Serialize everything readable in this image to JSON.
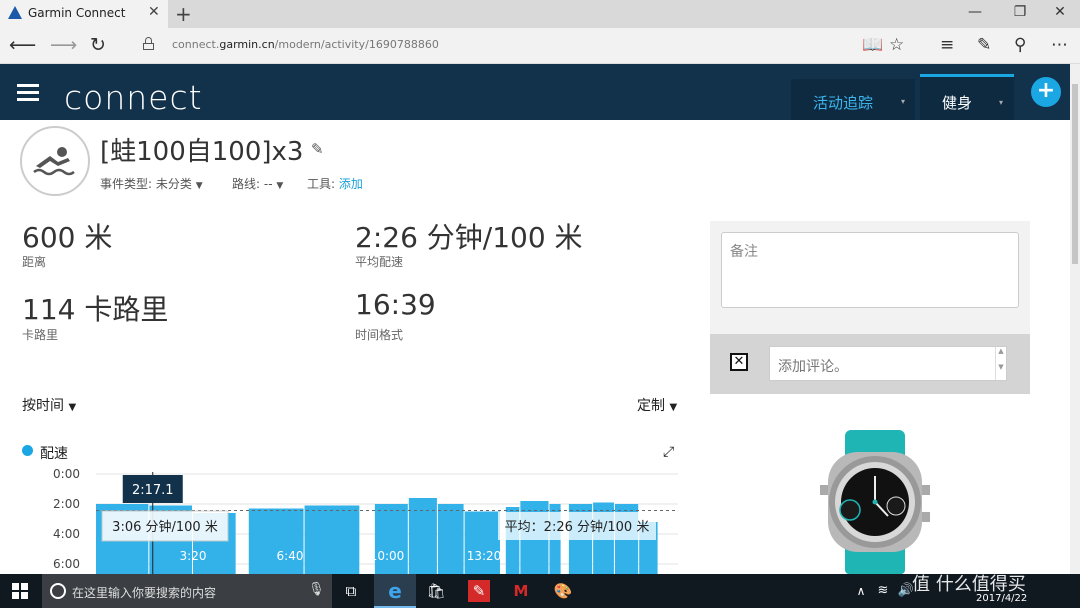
{
  "browser": {
    "tab_title": "Garmin Connect",
    "tab_close": "✕",
    "new_tab": "+",
    "url_prefix": "connect.",
    "url_domain": "garmin.cn",
    "url_path": "/modern/activity/1690788860",
    "win_min": "—",
    "win_max": "❐",
    "win_close": "✕"
  },
  "header": {
    "brand": "connect",
    "nav_activity": "活动追踪",
    "nav_fitness": "健身",
    "caret": "▾",
    "add": "+"
  },
  "activity": {
    "title": "[蛙100自100]x3",
    "event_type_label": "事件类型: ",
    "event_type_value": "未分类",
    "route_label": "路线: ",
    "route_value": "--",
    "tool_label": "工具: ",
    "tool_link": "添加",
    "caret": "▼"
  },
  "stats": [
    {
      "value": "600 米",
      "label": "距离"
    },
    {
      "value": "2:26 分钟/100 米",
      "label": "平均配速"
    },
    {
      "value": "114 卡路里",
      "label": "卡路里"
    },
    {
      "value": "16:39",
      "label": "时间格式"
    }
  ],
  "chart_controls": {
    "by_time": "按时间",
    "customize": "定制",
    "caret": "▼",
    "legend": "配速"
  },
  "chart_data": {
    "type": "bar",
    "title": "",
    "xlabel": "",
    "ylabel": "",
    "y_ticks": [
      "0:00",
      "2:00",
      "4:00",
      "6:00"
    ],
    "y_reversed": true,
    "ylim": [
      0,
      6
    ],
    "x_ticks": [
      "3:20",
      "6:40",
      "10:00",
      "13:20"
    ],
    "series": [
      {
        "name": "配速",
        "color": "#33b2ea",
        "bars": [
          {
            "start_s": 0,
            "end_s": 110,
            "pace_min": 2.0
          },
          {
            "start_s": 110,
            "end_s": 200,
            "pace_min": 2.1
          },
          {
            "start_s": 200,
            "end_s": 290,
            "pace_min": 2.6
          },
          {
            "start_s": 315,
            "end_s": 430,
            "pace_min": 2.3
          },
          {
            "start_s": 430,
            "end_s": 545,
            "pace_min": 2.1
          },
          {
            "start_s": 575,
            "end_s": 645,
            "pace_min": 2.0
          },
          {
            "start_s": 645,
            "end_s": 705,
            "pace_min": 1.6
          },
          {
            "start_s": 705,
            "end_s": 760,
            "pace_min": 2.0
          },
          {
            "start_s": 760,
            "end_s": 835,
            "pace_min": 2.5
          },
          {
            "start_s": 845,
            "end_s": 875,
            "pace_min": 2.2
          },
          {
            "start_s": 875,
            "end_s": 935,
            "pace_min": 1.8
          },
          {
            "start_s": 935,
            "end_s": 960,
            "pace_min": 2.0
          },
          {
            "start_s": 975,
            "end_s": 1025,
            "pace_min": 2.0
          },
          {
            "start_s": 1025,
            "end_s": 1070,
            "pace_min": 1.9
          },
          {
            "start_s": 1070,
            "end_s": 1120,
            "pace_min": 2.0
          },
          {
            "start_s": 1120,
            "end_s": 1160,
            "pace_min": 3.2
          }
        ]
      }
    ],
    "average_line": {
      "pace_min": 2.43,
      "label": "平均：2:26 分钟/100 米"
    },
    "cursor": {
      "time_s": 117,
      "time_label": "2:17.1",
      "value_label": "3:06 分钟/100 米"
    }
  },
  "notes": {
    "placeholder": "备注",
    "comment_placeholder": "添加评论。",
    "close": "✕"
  },
  "taskbar": {
    "search_placeholder": "在这里输入你要搜索的内容",
    "date": "2017/4/22",
    "watermark": "值 什么值得买"
  }
}
